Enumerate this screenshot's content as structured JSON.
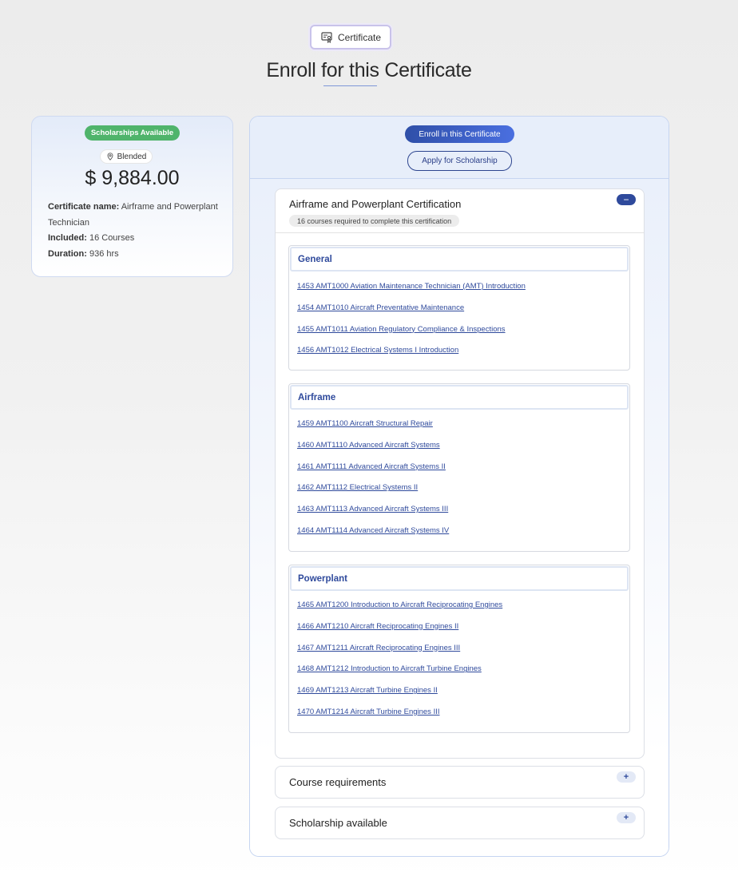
{
  "header": {
    "pill_label": "Certificate",
    "pill_icon": "certificate-icon",
    "title": "Enroll for this Certificate"
  },
  "summary": {
    "scholarship_badge": "Scholarships Available",
    "mode": "Blended",
    "mode_icon": "location-pin-icon",
    "price": "$ 9,884.00",
    "cert_name_label": "Certificate name:",
    "cert_name_value": "Airframe and Powerplant Technician",
    "included_label": "Included:",
    "included_value": "16 Courses",
    "duration_label": "Duration:",
    "duration_value": "936 hrs"
  },
  "actions": {
    "enroll": "Enroll in this Certificate",
    "apply": "Apply for Scholarship"
  },
  "certification": {
    "title": "Airframe and Powerplant Certification",
    "subtitle": "16 courses required to complete this certification",
    "toggle": "−",
    "groups": [
      {
        "name": "General",
        "courses": [
          "1453 AMT1000 Aviation Maintenance Technician (AMT) Introduction",
          "1454 AMT1010 Aircraft Preventative Maintenance",
          "1455 AMT1011 Aviation Regulatory Compliance & Inspections",
          "1456 AMT1012 Electrical Systems I Introduction"
        ]
      },
      {
        "name": "Airframe",
        "courses": [
          "1459 AMT1100 Aircraft Structural Repair",
          "1460 AMT1110 Advanced Aircraft Systems",
          "1461 AMT1111 Advanced Aircraft Systems II",
          "1462 AMT1112 Electrical Systems II",
          "1463 AMT1113 Advanced Aircraft Systems III",
          "1464 AMT1114 Advanced Aircraft Systems IV"
        ]
      },
      {
        "name": "Powerplant",
        "courses": [
          "1465 AMT1200 Introduction to Aircraft Reciprocating Engines",
          "1466 AMT1210 Aircraft Reciprocating Engines II",
          "1467 AMT1211 Aircraft Reciprocating Engines III",
          "1468 AMT1212 Introduction to Aircraft Turbine Engines",
          "1469 AMT1213 Aircraft Turbine Engines II",
          "1470 AMT1214 Aircraft Turbine Engines III"
        ]
      }
    ]
  },
  "sections": {
    "requirements": "Course requirements",
    "scholarship": "Scholarship available",
    "toggle": "+"
  },
  "colors": {
    "accent": "#2f4a9c",
    "success": "#4fb46b"
  }
}
